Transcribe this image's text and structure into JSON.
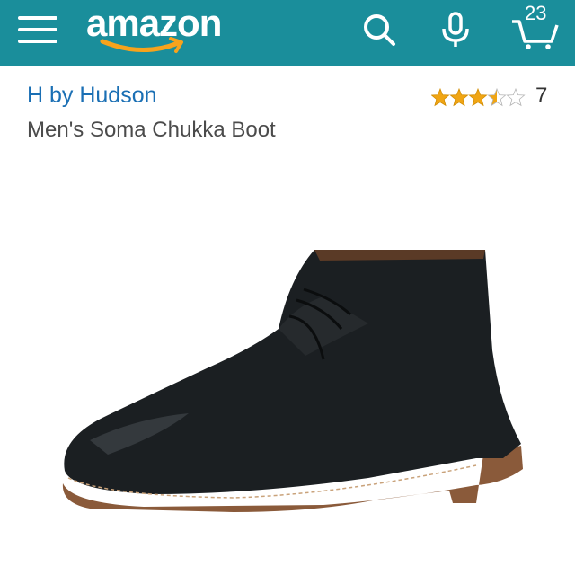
{
  "header": {
    "logo_text": "amazon",
    "cart_count": "23",
    "icons": [
      "menu-icon",
      "search-icon",
      "microphone-icon",
      "cart-icon"
    ],
    "colors": {
      "bar": "#1a8e9b",
      "brand_link": "#1a6fb4",
      "star": "#f0a514"
    }
  },
  "product": {
    "brand": "H by Hudson",
    "title": "Men's Soma Chukka Boot",
    "rating": {
      "stars": 3.5,
      "max": 5,
      "count": "7"
    }
  }
}
